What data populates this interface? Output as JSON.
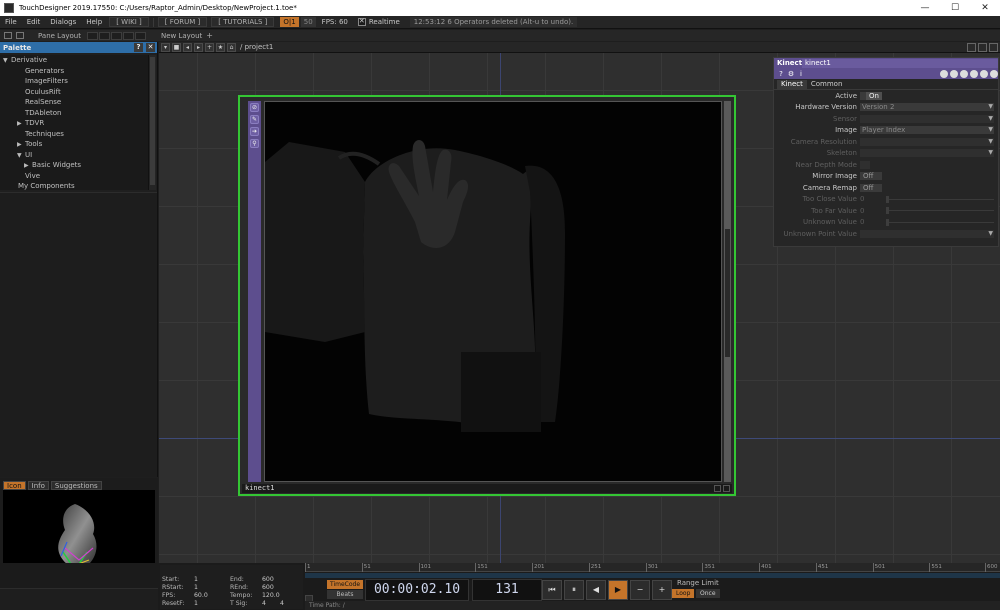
{
  "window": {
    "title": "TouchDesigner 2019.17550: C:/Users/Raptor_Admin/Desktop/NewProject.1.toe*",
    "minimize": "—",
    "maximize": "☐",
    "close": "✕"
  },
  "menu": {
    "items": [
      "File",
      "Edit",
      "Dialogs",
      "Help"
    ],
    "wiki": "[ WIKI ]",
    "forum": "[ FORUM ]",
    "tutorials": "[ TUTORIALS ]",
    "oi_badge": "O|1",
    "cpu_badge": "50",
    "fps": "FPS:  60",
    "realtime": "Realtime",
    "status": "12:53:12 6 Operators deleted (Alt-u to undo)."
  },
  "pane_bar": {
    "pane_layout": "Pane Layout",
    "new_layout": "New Layout",
    "add": "+"
  },
  "palette": {
    "title": "Palette",
    "help": "?",
    "close": "✕",
    "tree": [
      {
        "label": "Derivative",
        "indent": 0,
        "arrow": "▼"
      },
      {
        "label": "Generators",
        "indent": 2,
        "arrow": ""
      },
      {
        "label": "ImageFilters",
        "indent": 2,
        "arrow": ""
      },
      {
        "label": "OculusRift",
        "indent": 2,
        "arrow": ""
      },
      {
        "label": "RealSense",
        "indent": 2,
        "arrow": ""
      },
      {
        "label": "TDAbleton",
        "indent": 2,
        "arrow": ""
      },
      {
        "label": "TDVR",
        "indent": 2,
        "arrow": "▶"
      },
      {
        "label": "Techniques",
        "indent": 2,
        "arrow": ""
      },
      {
        "label": "Tools",
        "indent": 2,
        "arrow": "▶"
      },
      {
        "label": "UI",
        "indent": 2,
        "arrow": "▼"
      },
      {
        "label": "Basic Widgets",
        "indent": 3,
        "arrow": "▶"
      },
      {
        "label": "Vive",
        "indent": 2,
        "arrow": ""
      },
      {
        "label": "My Components",
        "indent": 1,
        "arrow": ""
      }
    ]
  },
  "info_panel": {
    "tabs": [
      "Icon",
      "Info",
      "Suggestions"
    ]
  },
  "network": {
    "path": "/ project1",
    "node_name": "kinect1"
  },
  "params": {
    "op_type": "Kinect",
    "op_name": "kinect1",
    "tabs": [
      "Kinect",
      "Common"
    ],
    "rows": [
      {
        "label": "Active",
        "kind": "toggle",
        "value": "On",
        "dim": false
      },
      {
        "label": "Hardware Version",
        "kind": "menu",
        "value": "Version 2",
        "dim": false
      },
      {
        "label": "Sensor",
        "kind": "menu",
        "value": "",
        "dim": true
      },
      {
        "label": "Image",
        "kind": "menu",
        "value": "Player Index",
        "dim": false
      },
      {
        "label": "Camera Resolution",
        "kind": "menu",
        "value": "",
        "dim": true
      },
      {
        "label": "Skeleton",
        "kind": "menu",
        "value": "",
        "dim": true
      },
      {
        "label": "Near Depth Mode",
        "kind": "small",
        "value": "",
        "dim": true
      },
      {
        "label": "Mirror Image",
        "kind": "toggle",
        "value": "Off",
        "dim": false
      },
      {
        "label": "Camera Remap",
        "kind": "toggle",
        "value": "Off",
        "dim": false
      },
      {
        "label": "Too Close Value",
        "kind": "slider",
        "value": "0",
        "dim": true
      },
      {
        "label": "Too Far Value",
        "kind": "slider",
        "value": "0",
        "dim": true
      },
      {
        "label": "Unknown Value",
        "kind": "slider",
        "value": "0",
        "dim": true
      },
      {
        "label": "Unknown Point Value",
        "kind": "menu",
        "value": "",
        "dim": true
      }
    ]
  },
  "timeline": {
    "stats": {
      "start_label": "Start:",
      "start": "1",
      "end_label": "End:",
      "end": "600",
      "rstart_label": "RStart:",
      "rstart": "1",
      "rend_label": "REnd:",
      "rend": "600",
      "fps_label": "FPS:",
      "fps": "60.0",
      "tempo_label": "Tempo:",
      "tempo": "120.0",
      "resetf_label": "ResetF:",
      "resetf": "1",
      "tsig_label": "T Sig:",
      "tsig_a": "4",
      "tsig_b": "4"
    },
    "ruler": [
      "1",
      "51",
      "101",
      "151",
      "201",
      "251",
      "301",
      "351",
      "401",
      "451",
      "501",
      "551",
      "600"
    ],
    "timecode_label": "TimeCode",
    "beats_label": "Beats",
    "clock": "00:00:02.10",
    "frame": "131",
    "buttons": [
      "⏮",
      "⏸",
      "◀",
      "▶",
      "−",
      "+"
    ],
    "range_limit": "Range Limit",
    "loop": "Loop",
    "once": "Once",
    "time_path": "Time Path: /"
  }
}
